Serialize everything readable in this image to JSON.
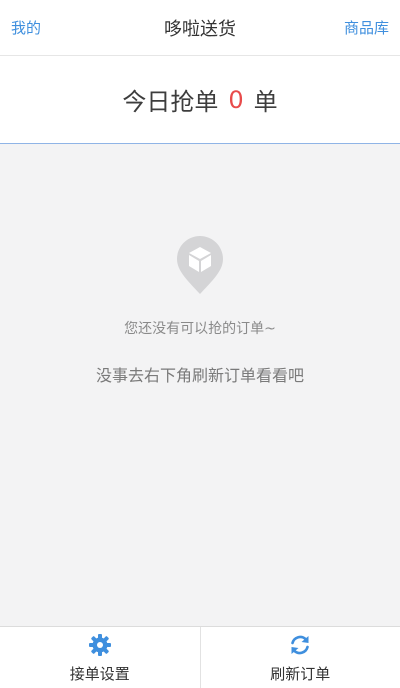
{
  "nav": {
    "left_label": "我的",
    "title": "哆啦送货",
    "right_label": "商品库"
  },
  "summary": {
    "prefix": "今日抢单",
    "count": "0",
    "suffix": "单"
  },
  "empty_state": {
    "icon": "package-pin-icon",
    "primary": "您还没有可以抢的订单~",
    "secondary": "没事去右下角刷新订单看看吧"
  },
  "tabbar": {
    "settings": {
      "icon": "gear-icon",
      "label": "接单设置"
    },
    "refresh": {
      "icon": "refresh-icon",
      "label": "刷新订单"
    }
  },
  "colors": {
    "accent": "#3f8fde",
    "count": "#e84b4b",
    "background": "#f3f3f4"
  }
}
